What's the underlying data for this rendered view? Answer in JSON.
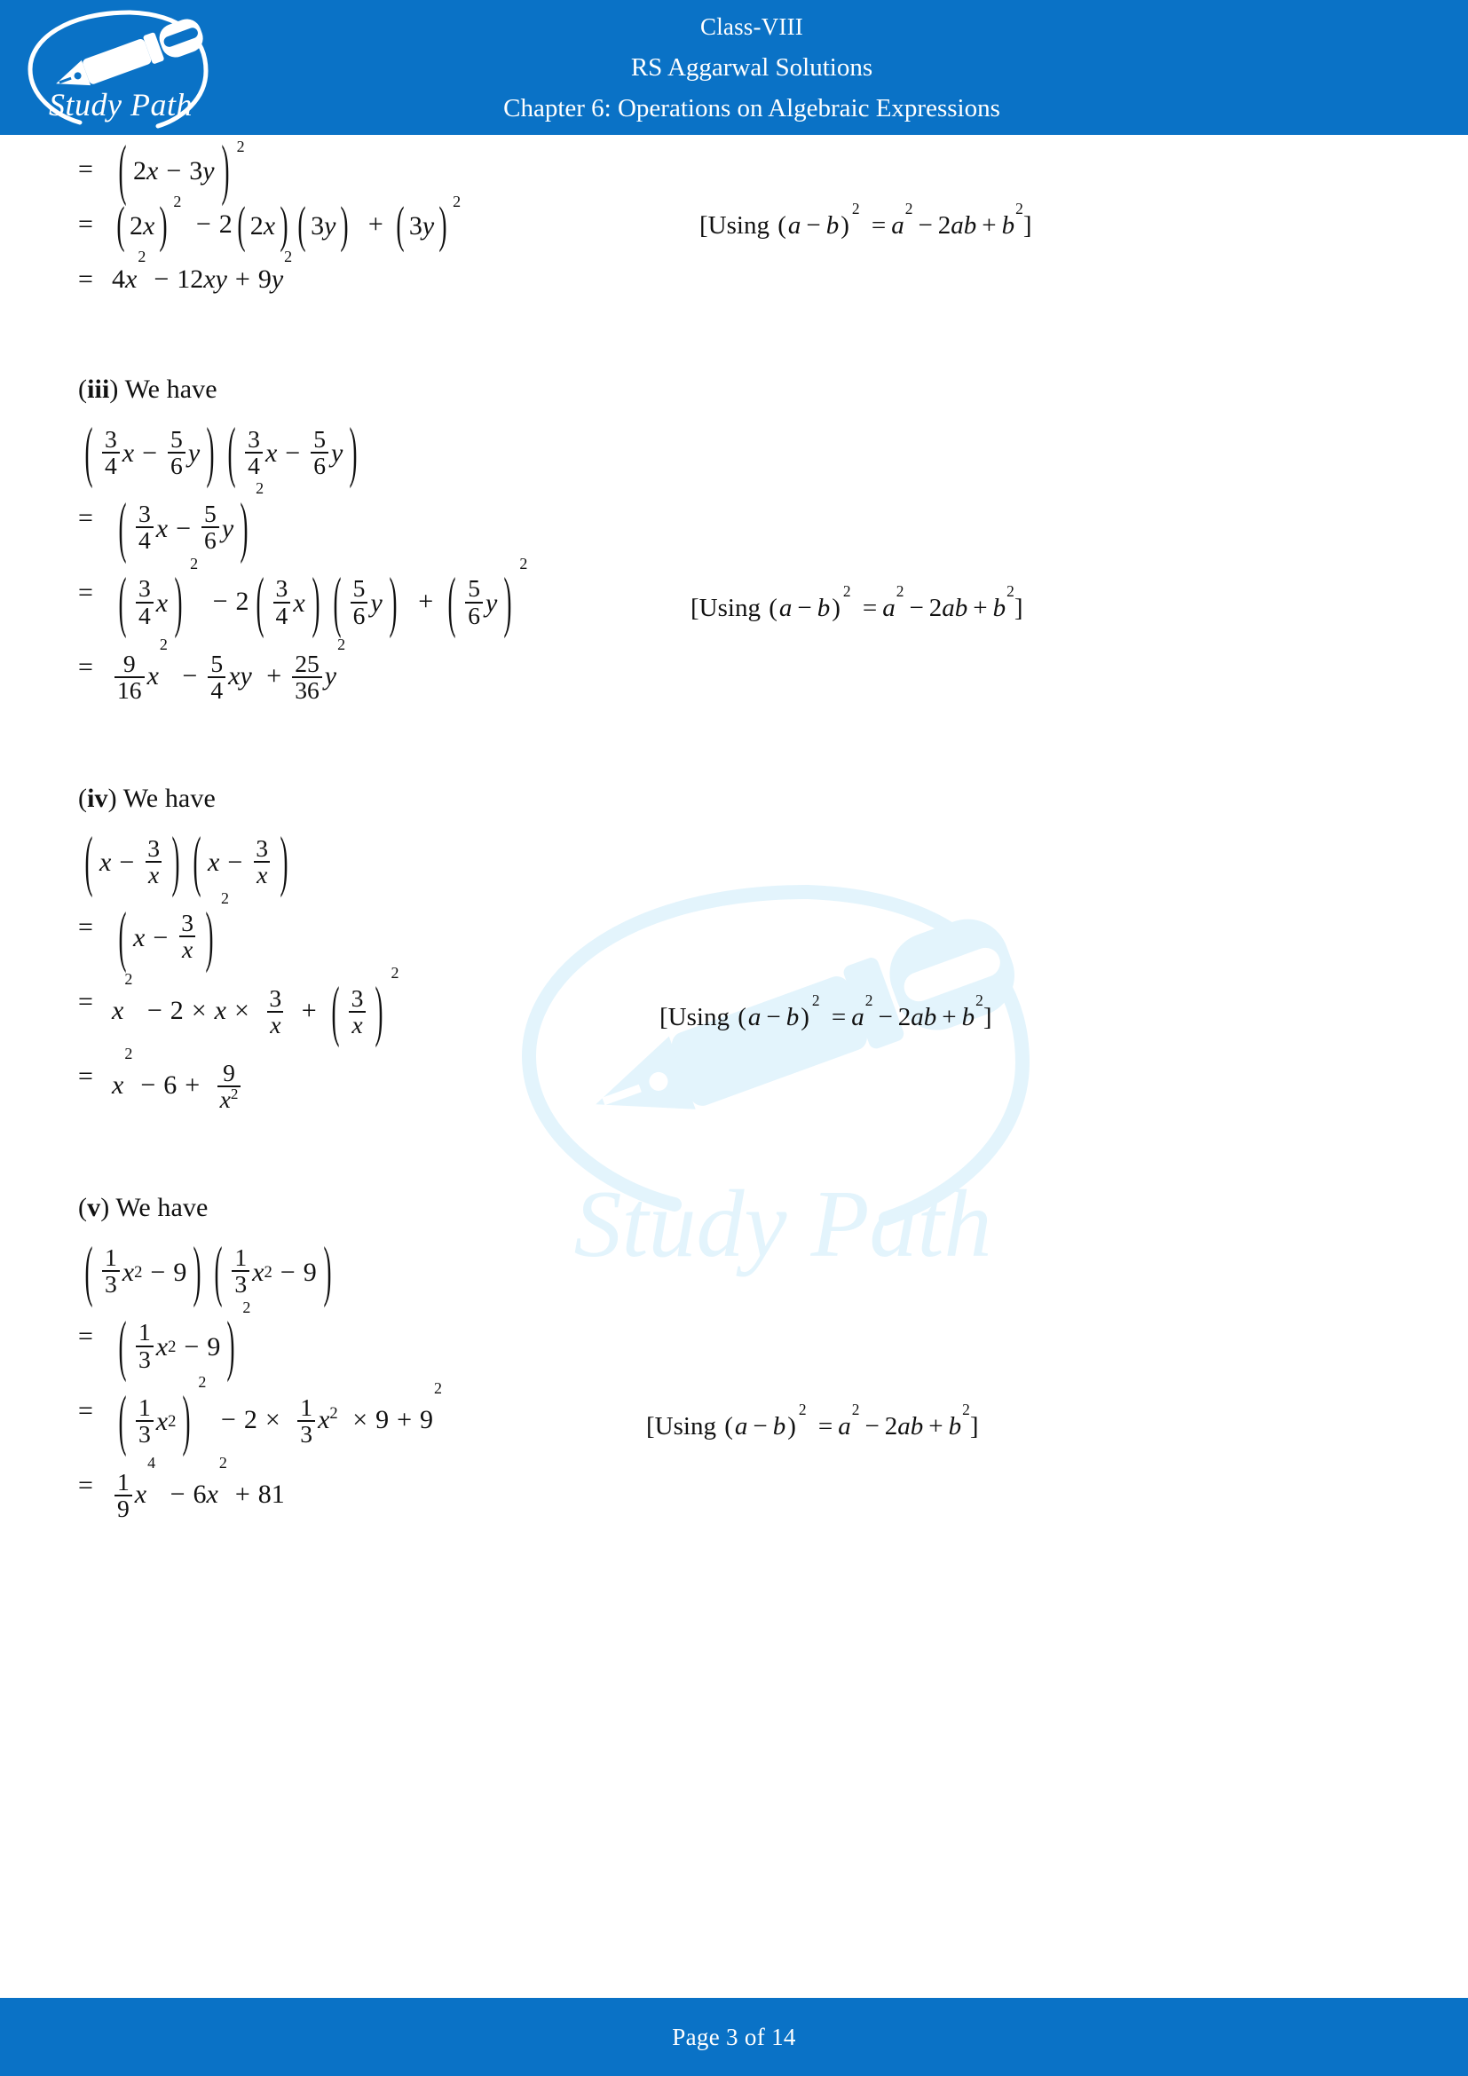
{
  "header": {
    "class_label": "Class-VIII",
    "book_label": "RS Aggarwal Solutions",
    "chapter_label": "Chapter 6: Operations on Algebraic Expressions",
    "logo_name": "Study Path",
    "brand_color": "#0a72c6"
  },
  "watermark": {
    "label": "Study Path",
    "color": "#e3f4fc"
  },
  "math": {
    "eq": "=",
    "minus": "−",
    "plus": "+",
    "times": "×",
    "lparen": "(",
    "rparen": ")",
    "lbracket": "[",
    "rbracket": "]",
    "sq": "2"
  },
  "identity_note": {
    "using": "Using",
    "lhs_a": "a",
    "lhs_b": "b",
    "rhs_a2": "a",
    "rhs_2ab": "2ab",
    "rhs_b2": "b",
    "full_text": "[Using (a − b)² = a² − 2ab + b²]"
  },
  "blocks": [
    {
      "id": "part-ii-tail",
      "label": "",
      "lines": [
        {
          "text": "= (2x − 3y)²"
        },
        {
          "text": "= (2x)² − 2(2x)(3y) + (3y)²",
          "note": "[Using (a − b)² = a² − 2ab + b²]"
        },
        {
          "text": "= 4x² − 12xy + 9y²"
        }
      ]
    },
    {
      "id": "part-iii",
      "label": "(iii) We have",
      "roman": "iii",
      "we_have": "We have",
      "lines": [
        {
          "text": "(3/4 x − 5/6 y)(3/4 x − 5/6 y)"
        },
        {
          "text": "= (3/4 x − 5/6 y)²"
        },
        {
          "text": "= (3/4 x)² − 2(3/4 x)(5/6 y) + (5/6 y)²",
          "note": "[Using (a − b)² = a² − 2ab + b²]"
        },
        {
          "text": "= 9/16 x² − 5/4 xy + 25/36 y²"
        }
      ]
    },
    {
      "id": "part-iv",
      "label": "(iv) We have",
      "roman": "iv",
      "we_have": "We have",
      "lines": [
        {
          "text": "(x − 3/x)(x − 3/x)"
        },
        {
          "text": "= (x − 3/x)²"
        },
        {
          "text": "= x² − 2 × x × 3/x + (3/x)²",
          "note": "[Using (a − b)² = a² − 2ab + b²]"
        },
        {
          "text": "= x² − 6 + 9/x²"
        }
      ]
    },
    {
      "id": "part-v",
      "label": "(v) We have",
      "roman": "v",
      "we_have": "We have",
      "lines": [
        {
          "text": "(1/3 x² − 9)(1/3 x² − 9)"
        },
        {
          "text": "= (1/3 x² − 9)²"
        },
        {
          "text": "= (1/3 x²)² − 2 × 1/3 x² × 9 + 9²",
          "note": "[Using (a − b)² = a² − 2ab + b²]"
        },
        {
          "text": "= 1/9 x⁴ − 6x² + 81"
        }
      ]
    }
  ],
  "numbers": {
    "n1": "1",
    "n2": "2",
    "n3": "3",
    "n4": "4",
    "n5": "5",
    "n6": "6",
    "n9": "9",
    "n16": "16",
    "n25": "25",
    "n36": "36",
    "n12": "12",
    "n81": "81",
    "n4p": "4"
  },
  "vars": {
    "x": "x",
    "y": "y",
    "a": "a",
    "b": "b"
  },
  "footer": {
    "prefix": "Page",
    "current": "3",
    "middle": "of",
    "total": "14",
    "full_text": "Page 3 of 14"
  }
}
